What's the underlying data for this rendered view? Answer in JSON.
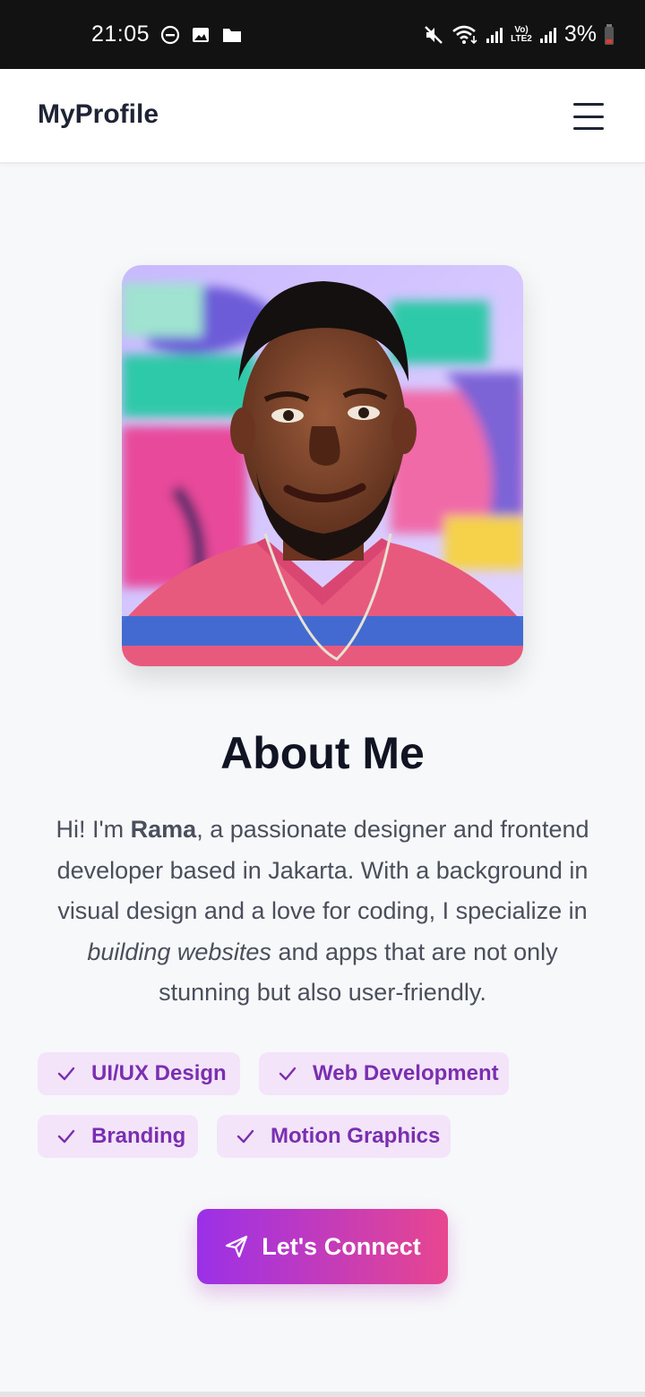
{
  "status_bar": {
    "time": "21:05",
    "battery": "3%",
    "lte_top": "Vo)",
    "lte_bottom": "LTE2",
    "left_icons": [
      "do-not-disturb-icon",
      "image-icon",
      "folder-icon"
    ],
    "right_icons": [
      "mute-icon",
      "wifi-icon",
      "signal-icon",
      "signal-icon",
      "battery-icon"
    ]
  },
  "navbar": {
    "brand": "MyProfile",
    "menu_icon": "hamburger-menu-icon"
  },
  "profile": {
    "photo_alt": "profile-photo"
  },
  "about": {
    "title": "About Me",
    "text_intro": "Hi! I'm ",
    "name": "Rama",
    "text_mid": ", a passionate designer and frontend developer based in Jakarta. With a background in visual design and a love for coding, I specialize in ",
    "emphasis": "building websites",
    "text_end": " and apps that are not only stunning but also user-friendly."
  },
  "skills": [
    {
      "label": "UI/UX Design",
      "icon": "check-icon"
    },
    {
      "label": "Web Development",
      "icon": "check-icon"
    },
    {
      "label": "Branding",
      "icon": "check-icon"
    },
    {
      "label": "Motion Graphics",
      "icon": "check-icon"
    }
  ],
  "cta": {
    "label": "Let's Connect",
    "icon": "send-icon"
  },
  "colors": {
    "accent_start": "#9b30e8",
    "accent_end": "#e8468f",
    "tag_bg": "#f3e4fa",
    "tag_text": "#7a2fb0"
  }
}
